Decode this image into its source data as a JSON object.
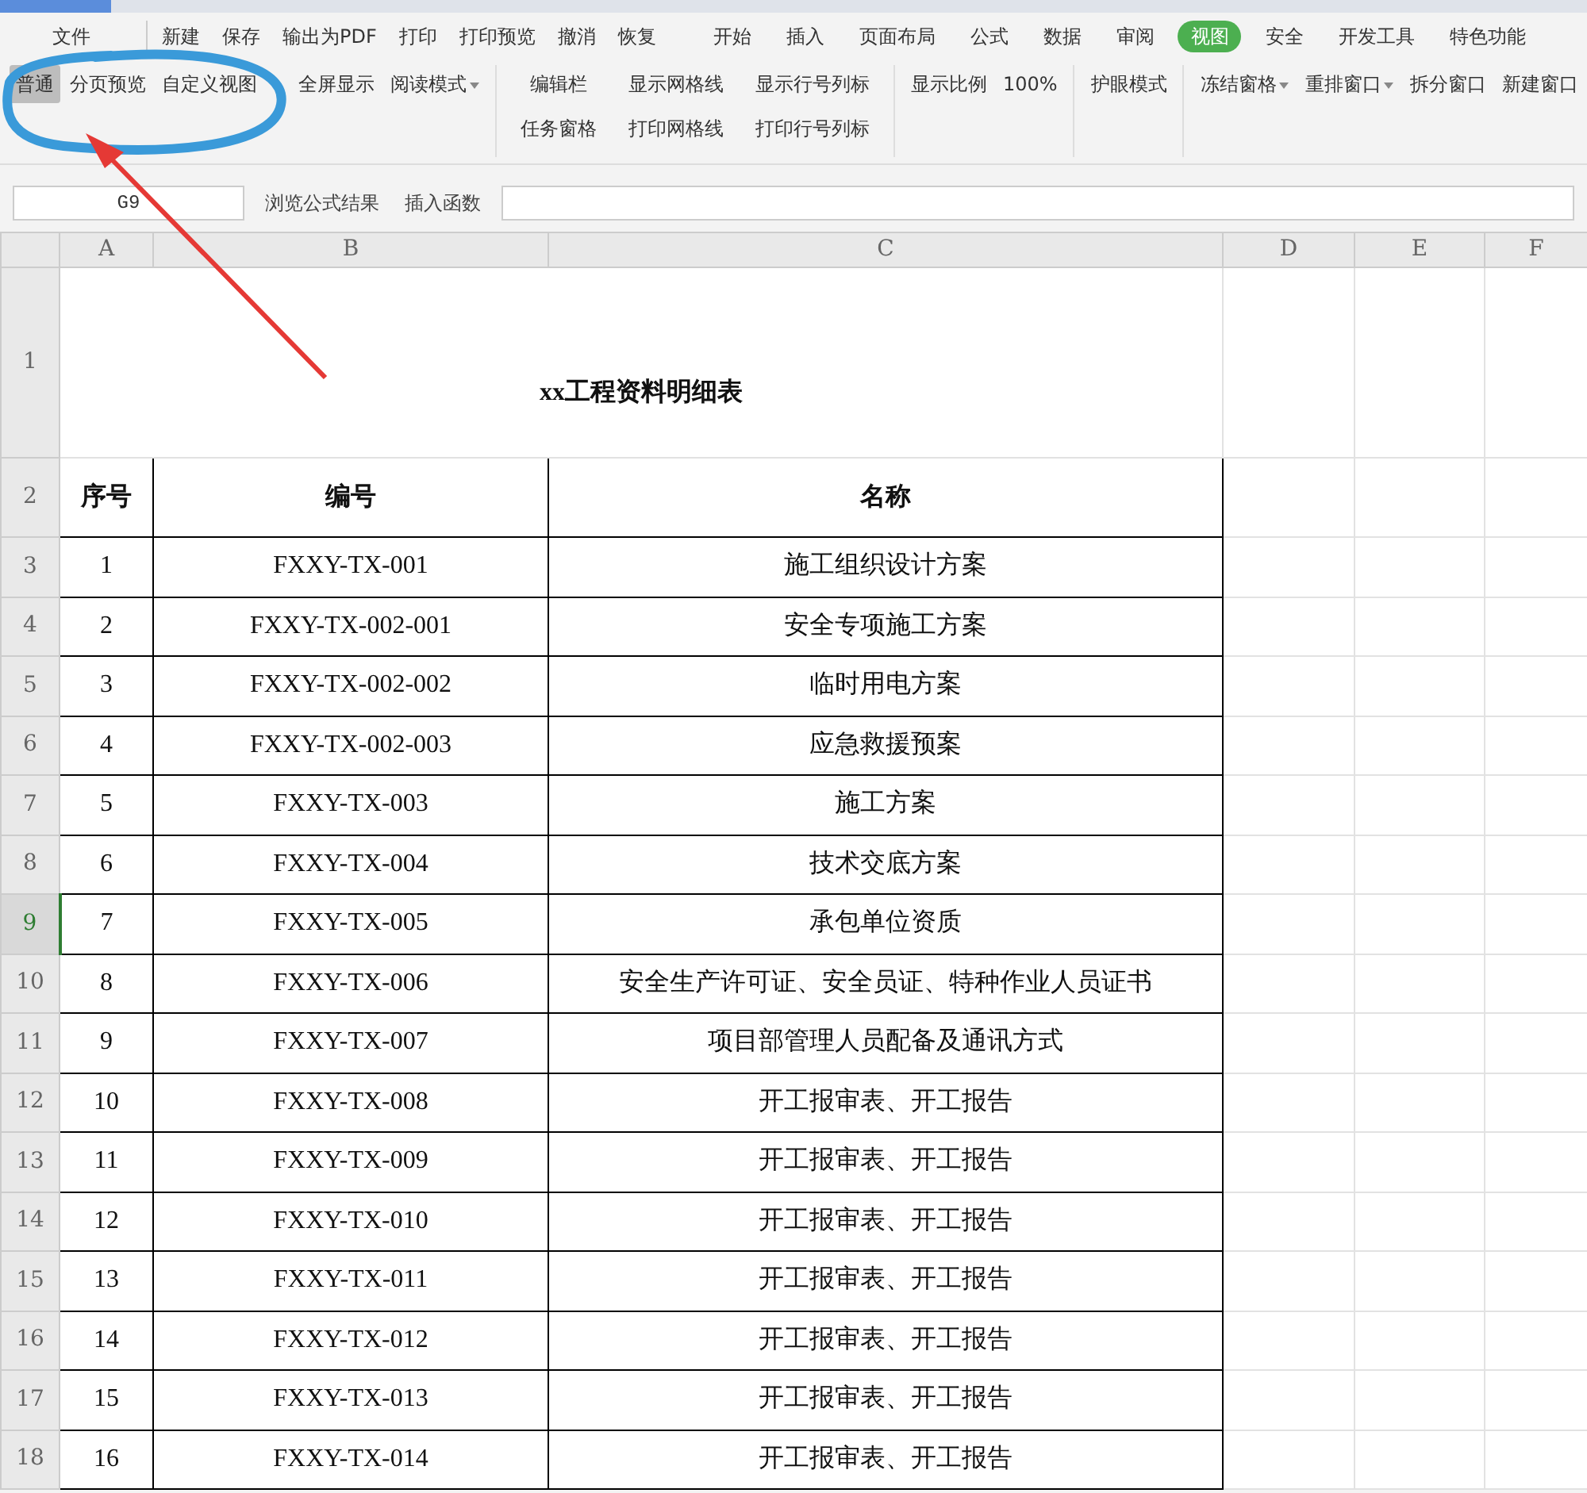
{
  "menu": {
    "file": "文件",
    "quick_actions": [
      "新建",
      "保存",
      "输出为PDF",
      "打印",
      "打印预览",
      "撤消",
      "恢复"
    ],
    "tabs": [
      {
        "label": "开始",
        "selected": false
      },
      {
        "label": "插入",
        "selected": false
      },
      {
        "label": "页面布局",
        "selected": false
      },
      {
        "label": "公式",
        "selected": false
      },
      {
        "label": "数据",
        "selected": false
      },
      {
        "label": "审阅",
        "selected": false
      },
      {
        "label": "视图",
        "selected": true
      },
      {
        "label": "安全",
        "selected": false
      },
      {
        "label": "开发工具",
        "selected": false
      },
      {
        "label": "特色功能",
        "selected": false
      }
    ]
  },
  "ribbon": {
    "view_modes": [
      {
        "label": "普通",
        "selected": true,
        "dropdown": false
      },
      {
        "label": "分页预览",
        "selected": false,
        "dropdown": false
      },
      {
        "label": "自定义视图",
        "selected": false,
        "dropdown": false
      },
      {
        "label": "全屏显示",
        "selected": false,
        "dropdown": false
      },
      {
        "label": "阅读模式",
        "selected": false,
        "dropdown": true
      }
    ],
    "show_options": [
      [
        "编辑栏",
        "任务窗格"
      ],
      [
        "显示网格线",
        "打印网格线"
      ],
      [
        "显示行号列标",
        "打印行号列标"
      ]
    ],
    "zoom": {
      "label": "显示比例",
      "value": "100%"
    },
    "eye_mode": "护眼模式",
    "window_actions": [
      {
        "label": "冻结窗格",
        "dropdown": true
      },
      {
        "label": "重排窗口",
        "dropdown": true
      },
      {
        "label": "拆分窗口",
        "dropdown": false
      },
      {
        "label": "新建窗口",
        "dropdown": false
      }
    ]
  },
  "formula_bar": {
    "name_box": "G9",
    "buttons": [
      "浏览公式结果",
      "插入函数"
    ]
  },
  "sheet": {
    "columns": [
      "A",
      "B",
      "C",
      "D",
      "E",
      "F"
    ],
    "row_headers": [
      {
        "label": "1",
        "selected": false
      },
      {
        "label": "2",
        "selected": false
      },
      {
        "label": "3",
        "selected": false
      },
      {
        "label": "4",
        "selected": false
      },
      {
        "label": "5",
        "selected": false
      },
      {
        "label": "6",
        "selected": false
      },
      {
        "label": "7",
        "selected": false
      },
      {
        "label": "8",
        "selected": false
      },
      {
        "label": "9",
        "selected": true
      },
      {
        "label": "10",
        "selected": false
      },
      {
        "label": "11",
        "selected": false
      },
      {
        "label": "12",
        "selected": false
      },
      {
        "label": "13",
        "selected": false
      },
      {
        "label": "14",
        "selected": false
      },
      {
        "label": "15",
        "selected": false
      },
      {
        "label": "16",
        "selected": false
      },
      {
        "label": "17",
        "selected": false
      },
      {
        "label": "18",
        "selected": false
      }
    ],
    "title": "xx工程资料明细表",
    "header": [
      "序号",
      "编号",
      "名称"
    ],
    "rows": [
      [
        "1",
        "FXXY-TX-001",
        "施工组织设计方案"
      ],
      [
        "2",
        "FXXY-TX-002-001",
        "安全专项施工方案"
      ],
      [
        "3",
        "FXXY-TX-002-002",
        "临时用电方案"
      ],
      [
        "4",
        "FXXY-TX-002-003",
        "应急救援预案"
      ],
      [
        "5",
        "FXXY-TX-003",
        "施工方案"
      ],
      [
        "6",
        "FXXY-TX-004",
        "技术交底方案"
      ],
      [
        "7",
        "FXXY-TX-005",
        "承包单位资质"
      ],
      [
        "8",
        "FXXY-TX-006",
        "安全生产许可证、安全员证、特种作业人员证书"
      ],
      [
        "9",
        "FXXY-TX-007",
        "项目部管理人员配备及通讯方式"
      ],
      [
        "10",
        "FXXY-TX-008",
        "开工报审表、开工报告"
      ],
      [
        "11",
        "FXXY-TX-009",
        "开工报审表、开工报告"
      ],
      [
        "12",
        "FXXY-TX-010",
        "开工报审表、开工报告"
      ],
      [
        "13",
        "FXXY-TX-011",
        "开工报审表、开工报告"
      ],
      [
        "14",
        "FXXY-TX-012",
        "开工报审表、开工报告"
      ],
      [
        "15",
        "FXXY-TX-013",
        "开工报审表、开工报告"
      ],
      [
        "16",
        "FXXY-TX-014",
        "开工报审表、开工报告"
      ]
    ]
  }
}
